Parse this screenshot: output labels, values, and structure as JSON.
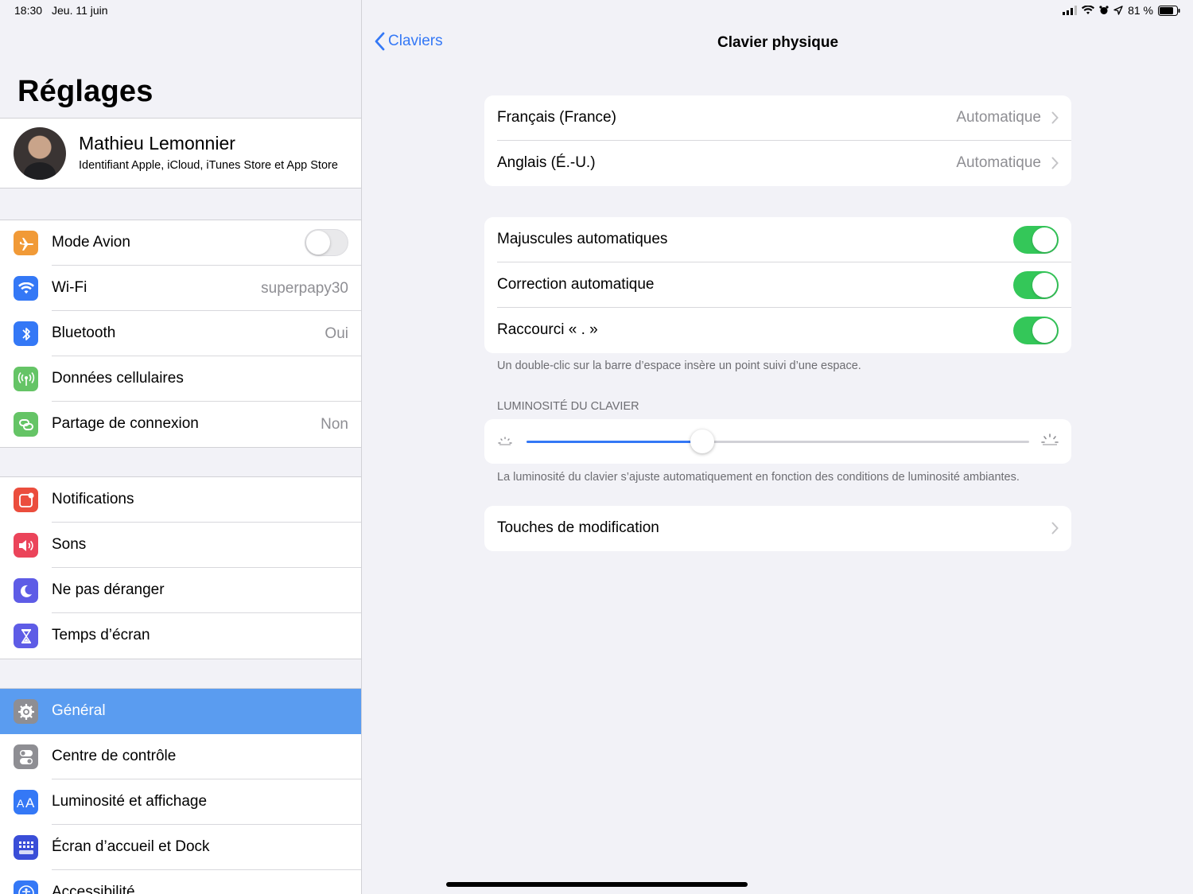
{
  "status_bar": {
    "time": "18:30",
    "date": "Jeu. 11 juin",
    "battery_percent": "81 %",
    "battery_level": 0.81,
    "icons": [
      "cellular-signal-icon",
      "wifi-icon",
      "alarm-icon",
      "location-icon",
      "battery-icon"
    ]
  },
  "sidebar": {
    "title": "Réglages",
    "profile": {
      "name": "Mathieu Lemonnier",
      "subtitle": "Identifiant Apple, iCloud, iTunes Store et App Store"
    },
    "group1": [
      {
        "label": "Mode Avion",
        "icon": "airplane-icon",
        "color": "#f19a37",
        "toggle": false
      },
      {
        "label": "Wi-Fi",
        "icon": "wifi-icon",
        "color": "#3478f6",
        "value": "superpapy30"
      },
      {
        "label": "Bluetooth",
        "icon": "bluetooth-icon",
        "color": "#3478f6",
        "value": "Oui"
      },
      {
        "label": "Données cellulaires",
        "icon": "antenna-icon",
        "color": "#65c466"
      },
      {
        "label": "Partage de connexion",
        "icon": "link-icon",
        "color": "#65c466",
        "value": "Non"
      }
    ],
    "group2": [
      {
        "label": "Notifications",
        "icon": "notifications-icon",
        "color": "#eb4d3d"
      },
      {
        "label": "Sons",
        "icon": "speaker-icon",
        "color": "#eb445a"
      },
      {
        "label": "Ne pas déranger",
        "icon": "moon-icon",
        "color": "#5e5ce6"
      },
      {
        "label": "Temps d’écran",
        "icon": "hourglass-icon",
        "color": "#5e5ce6"
      }
    ],
    "group3": [
      {
        "label": "Général",
        "icon": "gear-icon",
        "color": "#8e8e93",
        "selected": true
      },
      {
        "label": "Centre de contrôle",
        "icon": "switches-icon",
        "color": "#8e8e93"
      },
      {
        "label": "Luminosité et affichage",
        "icon": "text-size-icon",
        "color": "#3478f6"
      },
      {
        "label": "Écran d’accueil et Dock",
        "icon": "grid-icon",
        "color": "#3a4ed8"
      },
      {
        "label": "Accessibilité",
        "icon": "accessibility-icon",
        "color": "#3478f6"
      }
    ]
  },
  "main": {
    "back_label": "Claviers",
    "title": "Clavier physique",
    "languages": [
      {
        "label": "Français (France)",
        "value": "Automatique"
      },
      {
        "label": "Anglais (É.-U.)",
        "value": "Automatique"
      }
    ],
    "options": [
      {
        "label": "Majuscules automatiques",
        "on": true
      },
      {
        "label": "Correction automatique",
        "on": true
      },
      {
        "label": "Raccourci « . »",
        "on": true
      }
    ],
    "options_footnote": "Un double-clic sur la barre d’espace insère un point suivi d’une espace.",
    "brightness_header": "LUMINOSITÉ DU CLAVIER",
    "brightness_level": 0.35,
    "brightness_footnote": "La luminosité du clavier s’ajuste automatiquement en fonction des conditions de luminosité ambiantes.",
    "modifier_keys_label": "Touches de modification",
    "accent_color": "#3478f6",
    "toggle_color": "#34c759"
  }
}
